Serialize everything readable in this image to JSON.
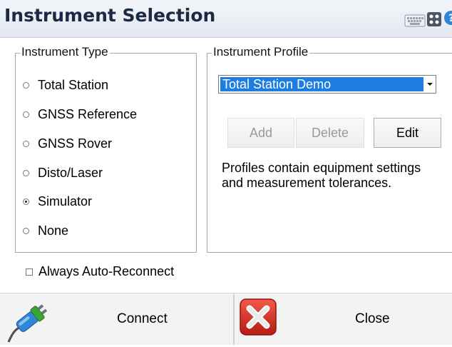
{
  "window": {
    "title": "Instrument Selection",
    "icons": [
      "keyboard-icon",
      "apps-icon",
      "help-icon"
    ]
  },
  "instrument_type": {
    "legend": "Instrument Type",
    "options": [
      {
        "label": "Total Station",
        "checked": false
      },
      {
        "label": "GNSS Reference",
        "checked": false
      },
      {
        "label": "GNSS Rover",
        "checked": false
      },
      {
        "label": "Disto/Laser",
        "checked": false
      },
      {
        "label": "Simulator",
        "checked": true
      },
      {
        "label": "None",
        "checked": false
      }
    ]
  },
  "instrument_profile": {
    "legend": "Instrument Profile",
    "selected": "Total Station Demo",
    "buttons": {
      "add": "Add",
      "delete": "Delete",
      "edit": "Edit"
    },
    "description": "Profiles contain equipment settings and measurement tolerances."
  },
  "auto_reconnect": {
    "label": "Always Auto-Reconnect",
    "checked": false
  },
  "footer": {
    "connect_label": "Connect",
    "close_label": "Close"
  },
  "colors": {
    "selection": "#1e7de0",
    "title_text": "#1b2a44",
    "close_red": "#d42a1e",
    "connect_green": "#3aa435"
  }
}
